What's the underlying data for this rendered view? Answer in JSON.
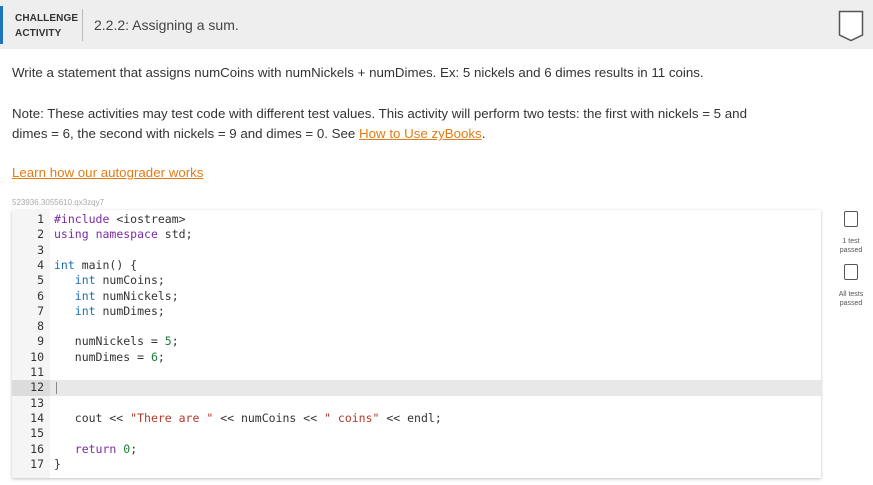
{
  "header": {
    "label_line1": "CHALLENGE",
    "label_line2": "ACTIVITY",
    "title": "2.2.2: Assigning a sum."
  },
  "instructions": {
    "para1": "Write a statement that assigns numCoins with numNickels + numDimes. Ex: 5 nickels and 6 dimes results in 11 coins.",
    "para2_line1": "Note: These activities may test code with different test values. This activity will perform two tests: the first with nickels = 5 and",
    "para2_line2_prefix": "dimes = 6, the second with nickels = 9 and dimes = 0. See ",
    "para2_link": "How to Use zyBooks",
    "para2_suffix": ".",
    "autograder_link": "Learn how our autograder works"
  },
  "editor": {
    "code_id": "523936.3055610.qx3zqy7",
    "line_numbers": [
      "1",
      "2",
      "3",
      "4",
      "5",
      "6",
      "7",
      "8",
      "9",
      "10",
      "11",
      "12",
      "13",
      "14",
      "15",
      "16",
      "17"
    ],
    "lines": [
      "#include <iostream>",
      "using namespace std;",
      "",
      "int main() {",
      "   int numCoins;",
      "   int numNickels;",
      "   int numDimes;",
      "",
      "   numNickels = 5;",
      "   numDimes = 6;",
      "",
      "",
      "",
      "   cout << \"There are \" << numCoins << \" coins\" << endl;",
      "",
      "   return 0;",
      "}"
    ],
    "active_line": 12
  },
  "tests": {
    "test1_line1": "1 test",
    "test1_line2": "passed",
    "test2_line1": "All tests",
    "test2_line2": "passed"
  }
}
